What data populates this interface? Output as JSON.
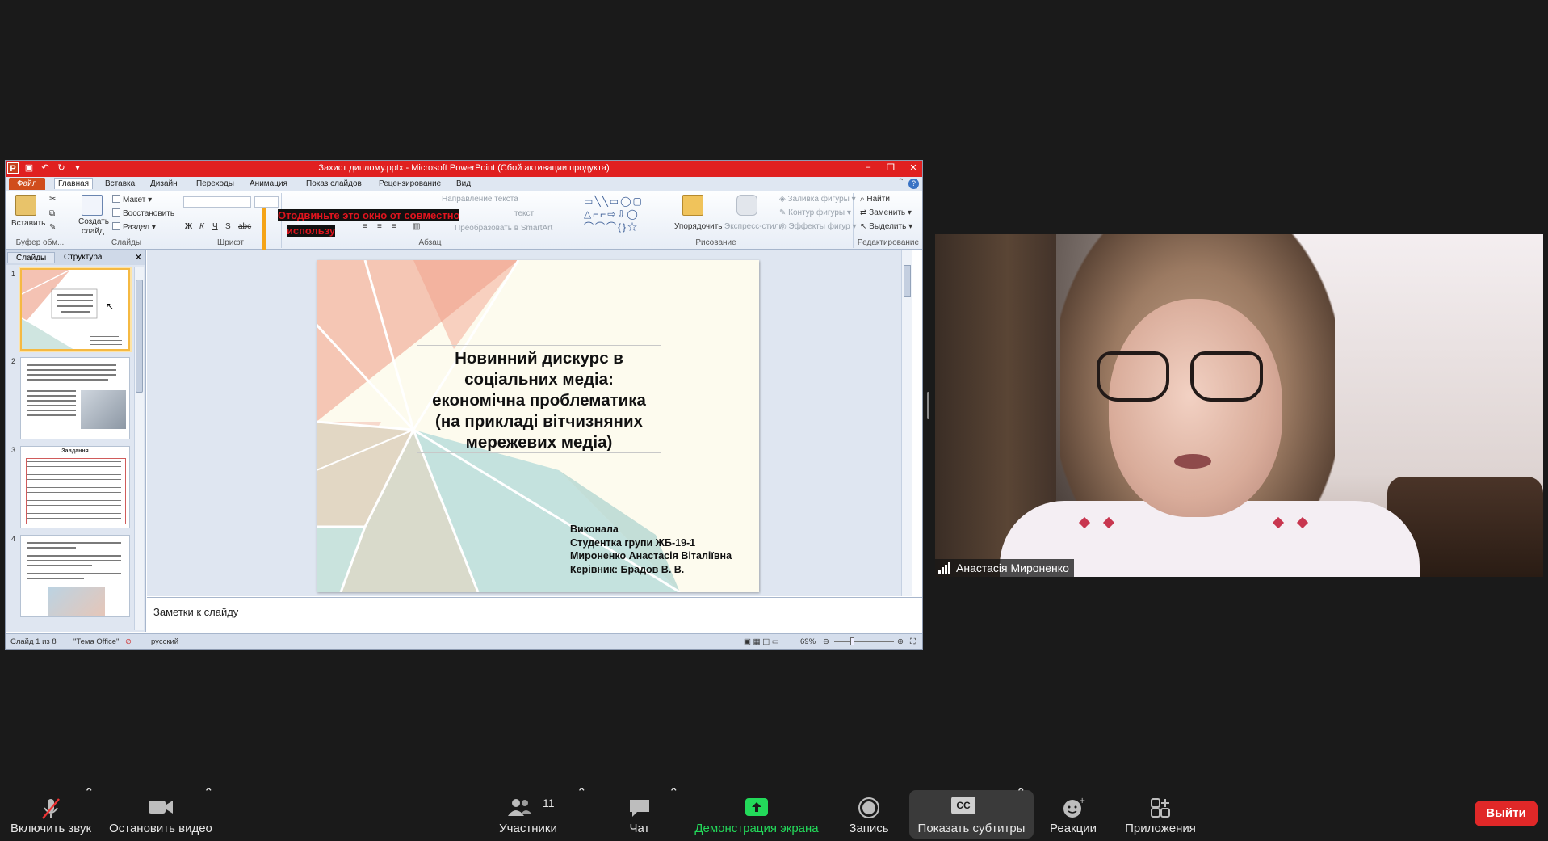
{
  "ppt": {
    "window_title": "Захист диплому.pptx - Microsoft PowerPoint (Сбой активации продукта)",
    "file_tab": "Файл",
    "tabs": [
      "Главная",
      "Вставка",
      "Дизайн",
      "Переходы",
      "Анимация",
      "Показ слайдов",
      "Рецензирование",
      "Вид"
    ],
    "ribbon": {
      "paste": "Вставить",
      "new_slide_1": "Создать",
      "new_slide_2": "слайд",
      "layout": "Макет",
      "reset": "Восстановить",
      "section": "Раздел",
      "clipboard_group": "Буфер обм...",
      "slides_group": "Слайды",
      "font_group": "Шрифт",
      "paragraph_group": "Абзац",
      "text_direction": "Направление текста",
      "align_text": "текст",
      "smartart": "Преобразовать в SmartArt",
      "arrange": "Упорядочить",
      "quick_styles": "Экспресс-стили",
      "shape_fill": "Заливка фигуры",
      "shape_outline": "Контур фигуры",
      "shape_effects": "Эффекты фигур",
      "drawing_group": "Рисование",
      "find": "Найти",
      "replace": "Заменить",
      "select": "Выделить",
      "editing_group": "Редактирование"
    },
    "overlay_message_1": "Отодвиньте это окно от совместно",
    "overlay_message_2": "использу",
    "panel_tabs": [
      "Слайды",
      "Структура"
    ],
    "thumb_numbers": [
      "1",
      "2",
      "3",
      "4"
    ],
    "thumb3_title": "Завдання",
    "slide": {
      "title_lines": [
        "Новинний дискурс в",
        "соціальних медіа:",
        "економічна проблематика",
        "(на прикладі вітчизняних",
        "мережевих медіа)"
      ],
      "author_lines": [
        "Виконала",
        "Студентка групи ЖБ-19-1",
        "Мироненко Анастасія Віталіївна",
        "Керівник: Брадов В. В."
      ]
    },
    "notes_placeholder": "Заметки к слайду",
    "status": {
      "slide_count": "Слайд 1 из 8",
      "theme": "\"Тема Office\"",
      "language": "русский",
      "zoom": "69%"
    }
  },
  "video": {
    "participant_name": "Анастасія Мироненко"
  },
  "toolbar": {
    "mute": "Включить звук",
    "video": "Остановить видео",
    "participants": "Участники",
    "participants_count": "11",
    "chat": "Чат",
    "share": "Демонстрация экрана",
    "record": "Запись",
    "captions": "Показать субтитры",
    "captions_icon": "CC",
    "reactions": "Реакции",
    "apps": "Приложения",
    "leave": "Выйти"
  },
  "colors": {
    "share_green": "#23d95a",
    "leave_red": "#e02828",
    "ppt_title_red": "#e02020",
    "overlay_orange": "#f5a417"
  }
}
